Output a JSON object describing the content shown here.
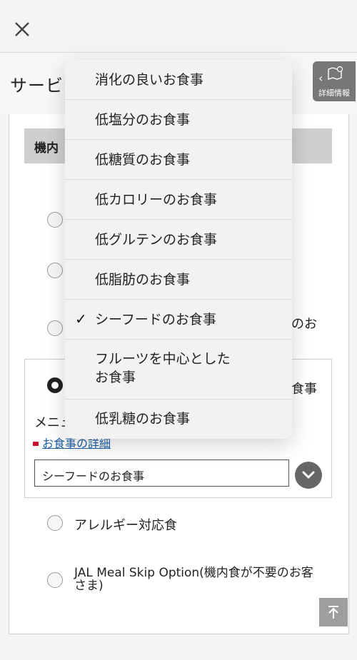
{
  "header": {
    "close_icon": "close-icon",
    "title": "サービ",
    "detail_button_label": "詳細情報"
  },
  "section": {
    "title": "機内"
  },
  "meal_options": {
    "right_fragment_1": "のお",
    "selected_fragment": "食事",
    "menu_label": "メニュ",
    "detail_link": "お食事の詳細",
    "selected_value": "シーフードのお食事",
    "allergy": "アレルギー対応食",
    "skip": "JAL Meal Skip Option(機内食が不要のお客さま)"
  },
  "dropdown": {
    "items": [
      {
        "label": "消化の良いお食事",
        "checked": false
      },
      {
        "label": "低塩分のお食事",
        "checked": false
      },
      {
        "label": "低糖質のお食事",
        "checked": false
      },
      {
        "label": "低カロリーのお食事",
        "checked": false
      },
      {
        "label": "低グルテンのお食事",
        "checked": false
      },
      {
        "label": "低脂肪のお食事",
        "checked": false
      },
      {
        "label": "シーフードのお食事",
        "checked": true
      },
      {
        "label": "フルーツを中心とした\nお食事",
        "checked": false
      },
      {
        "label": "低乳糖のお食事",
        "checked": false
      }
    ],
    "check_mark": "✓"
  },
  "back_to_top_icon": "arrow-up-icon"
}
